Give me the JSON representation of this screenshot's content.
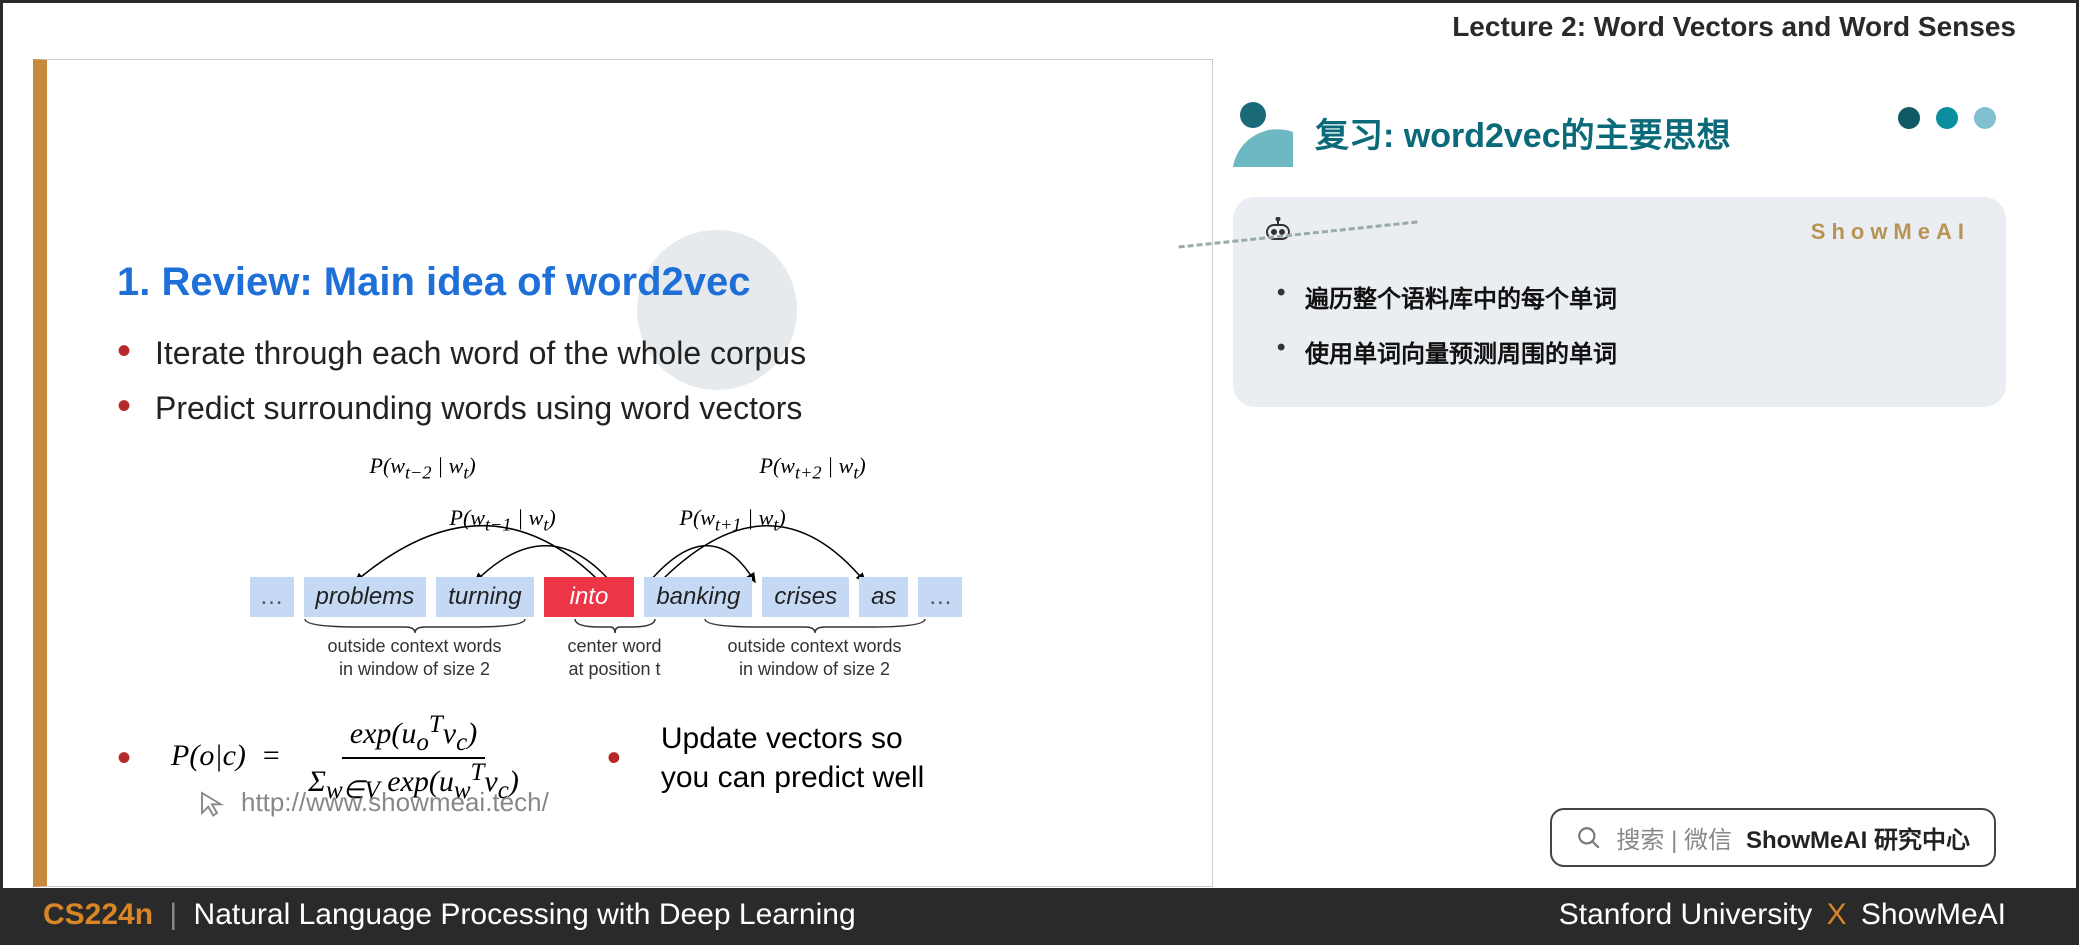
{
  "header": {
    "lecture": "Lecture 2:  Word Vectors and Word Senses"
  },
  "slide": {
    "title": "1. Review: Main idea of word2vec",
    "bullets": [
      "Iterate through each word of the whole corpus",
      "Predict surrounding words using word vectors"
    ],
    "diagram": {
      "prob_labels": {
        "pm2": "P(w_{t−2} | w_t)",
        "pm1": "P(w_{t−1} | w_t)",
        "pp1": "P(w_{t+1} | w_t)",
        "pp2": "P(w_{t+2} | w_t)"
      },
      "tokens": [
        "…",
        "problems",
        "turning",
        "into",
        "banking",
        "crises",
        "as",
        "…"
      ],
      "center_index": 3,
      "brace_left": {
        "line1": "outside context words",
        "line2": "in window of size 2"
      },
      "brace_center": {
        "line1": "center word",
        "line2": "at position t"
      },
      "brace_right": {
        "line1": "outside context words",
        "line2": "in window of size 2"
      }
    },
    "formula": {
      "lhs": "P(o|c)  =",
      "num": "exp(uᵒᵀ v_c)",
      "den": "Σ_{w∈V} exp(u_wᵀ v_c)"
    },
    "update_bullet": "Update vectors so you can predict well",
    "site_url": "http://www.showmeai.tech/"
  },
  "right": {
    "title": "复习: word2vec的主要思想",
    "brand": "ShowMeAI",
    "bullets": [
      "遍历整个语料库中的每个单词",
      "使用单词向量预测周围的单词"
    ],
    "dots_colors": [
      "#0f5a63",
      "#0a8d9c",
      "#7fbfd0"
    ]
  },
  "search": {
    "prefix": "搜索 | 微信",
    "bold": "ShowMeAI 研究中心"
  },
  "footer": {
    "course": "CS224n",
    "subtitle": "Natural Language Processing with Deep Learning",
    "right_a": "Stanford University",
    "right_x": "X",
    "right_b": "ShowMeAI"
  },
  "colors": {
    "accent_blue": "#1f6fd9",
    "accent_red": "#b5292c",
    "teal": "#0a6a79",
    "orange": "#d88626"
  }
}
